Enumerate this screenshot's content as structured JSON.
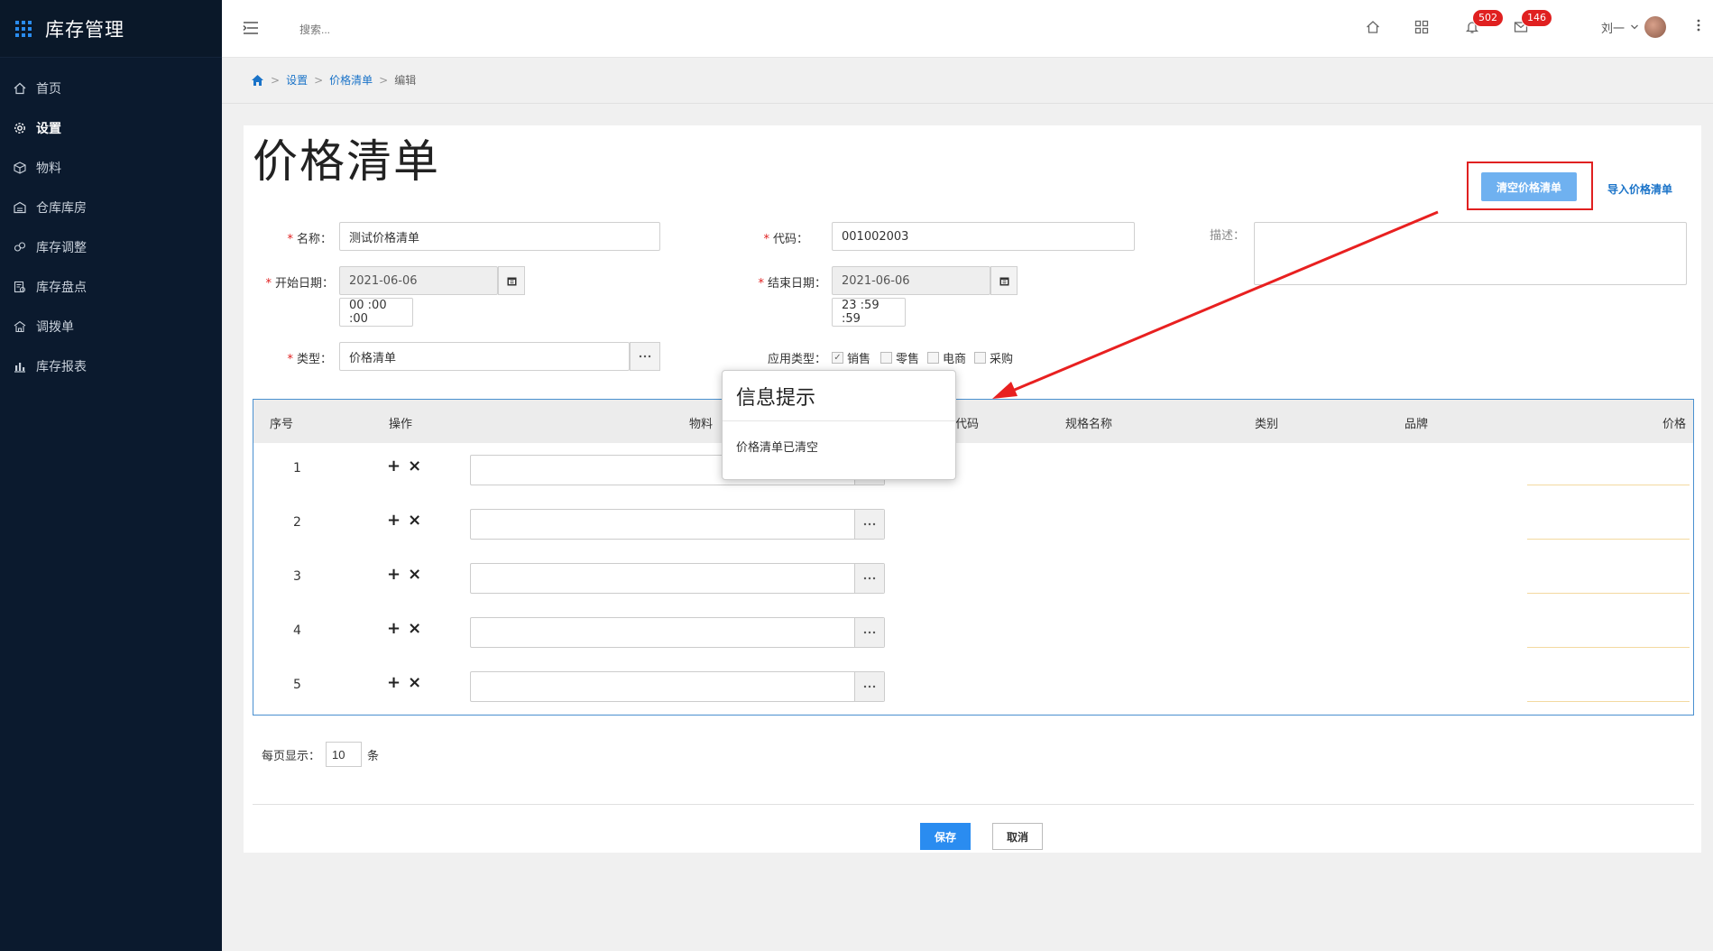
{
  "app": {
    "title": "库存管理"
  },
  "sidebar": {
    "items": [
      {
        "label": "首页",
        "icon": "home-icon"
      },
      {
        "label": "设置",
        "icon": "gear-icon"
      },
      {
        "label": "物料",
        "icon": "box-icon"
      },
      {
        "label": "仓库库房",
        "icon": "warehouse-icon"
      },
      {
        "label": "库存调整",
        "icon": "adjust-icon"
      },
      {
        "label": "库存盘点",
        "icon": "inventory-icon"
      },
      {
        "label": "调拨单",
        "icon": "transfer-icon"
      },
      {
        "label": "库存报表",
        "icon": "report-icon"
      }
    ],
    "active": "设置"
  },
  "topbar": {
    "search_placeholder": "搜索...",
    "notifications_count": "502",
    "messages_count": "146",
    "user_name": "刘一"
  },
  "breadcrumb": {
    "items": [
      "设置",
      "价格清单"
    ],
    "current": "编辑"
  },
  "page": {
    "title": "价格清单",
    "clear_button": "清空价格清单",
    "import_link": "导入价格清单"
  },
  "form": {
    "name_label": "名称：",
    "name_value": "测试价格清单",
    "code_label": "代码：",
    "code_value": "001002003",
    "desc_label": "描述：",
    "start_label": "开始日期：",
    "start_date": "2021-06-06",
    "start_time": "00 :00 :00",
    "end_label": "结束日期：",
    "end_date": "2021-06-06",
    "end_time": "23 :59 :59",
    "type_label": "类型：",
    "type_value": "价格清单",
    "apply_label": "应用类型：",
    "apply_options": [
      {
        "label": "销售",
        "checked": true
      },
      {
        "label": "零售",
        "checked": false
      },
      {
        "label": "电商",
        "checked": false
      },
      {
        "label": "采购",
        "checked": false
      }
    ]
  },
  "table": {
    "columns": [
      "序号",
      "操作",
      "物料",
      "代码",
      "规格名称",
      "类别",
      "品牌",
      "价格"
    ],
    "rows": [
      "1",
      "2",
      "3",
      "4",
      "5"
    ]
  },
  "pager": {
    "label": "每页显示：",
    "value": "10",
    "unit": "条"
  },
  "buttons": {
    "save": "保存",
    "cancel": "取消"
  },
  "dialog": {
    "title": "信息提示",
    "message": "价格清单已清空"
  },
  "colors": {
    "sidebar_bg": "#0b1a2e",
    "primary": "#2a8cf0",
    "highlight": "#e02020"
  }
}
